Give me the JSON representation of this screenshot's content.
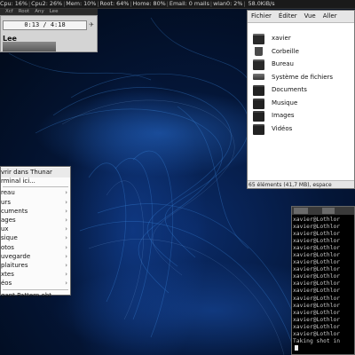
{
  "topbar": {
    "items": [
      {
        "label": "Cpu:",
        "value": "16%"
      },
      {
        "label": "Cpu2:",
        "value": "26%"
      },
      {
        "label": "Mem:",
        "value": "10%"
      },
      {
        "label": "Root:",
        "value": "64%"
      },
      {
        "label": "Home:",
        "value": "80%"
      },
      {
        "label": "Email:",
        "value": "0 mails"
      },
      {
        "label": "wlan0:",
        "value": "2%"
      },
      {
        "label": "",
        "value": "58.0KiB/s"
      }
    ]
  },
  "taskbar_tabs": [
    "Xcf",
    "Root",
    "Any",
    "Lee"
  ],
  "player": {
    "time": "0:13 / 4:18",
    "artist": "Lee",
    "button_glyph": "✈"
  },
  "file_manager": {
    "menu": [
      "Fichier",
      "Éditer",
      "Vue",
      "Aller"
    ],
    "items": [
      {
        "label": "xavier",
        "icon": "home-folder-icon"
      },
      {
        "label": "Corbeille",
        "icon": "trash-icon"
      },
      {
        "label": "Bureau",
        "icon": "desktop-folder-icon"
      },
      {
        "label": "Système de fichiers",
        "icon": "drive-icon"
      },
      {
        "label": "Documents",
        "icon": "folder-icon"
      },
      {
        "label": "Musique",
        "icon": "folder-icon"
      },
      {
        "label": "Images",
        "icon": "folder-icon"
      },
      {
        "label": "Vidéos",
        "icon": "folder-icon"
      }
    ],
    "status": "65 éléments (41,7 MB), espace"
  },
  "context_menu": {
    "items": [
      {
        "label": "vrir dans Thunar",
        "submenu": false
      },
      {
        "label": "rminal ici...",
        "submenu": false
      },
      {
        "label": "reau",
        "submenu": true
      },
      {
        "label": "urs",
        "submenu": true
      },
      {
        "label": "cuments",
        "submenu": true
      },
      {
        "label": "ages",
        "submenu": true
      },
      {
        "label": "ux",
        "submenu": true
      },
      {
        "label": "sique",
        "submenu": true
      },
      {
        "label": "otos",
        "submenu": true
      },
      {
        "label": "uvegarde",
        "submenu": true
      },
      {
        "label": "plaitures",
        "submenu": true
      },
      {
        "label": "xtes",
        "submenu": true
      },
      {
        "label": "éos",
        "submenu": true
      },
      {
        "label": "gant Pattern.obt",
        "submenu": false
      }
    ]
  },
  "terminal": {
    "tabs": [
      "",
      ""
    ],
    "lines": [
      "xavier@Lothlor",
      "xavier@Lothlor",
      "xavier@Lothlor",
      "xavier@Lothlor",
      "xavier@Lothlor",
      "xavier@Lothlor",
      "xavier@Lothlor",
      "xavier@Lothlor",
      "xavier@Lothlor",
      "xavier@Lothlor",
      "xavier@Lothlor",
      "xavier@Lothlor",
      "xavier@Lothlor",
      "xavier@Lothlor",
      "xavier@Lothlor",
      "xavier@Lothlor",
      "xavier@Lothlor",
      "Taking shot in"
    ]
  },
  "colors": {
    "wallpaper": "#041638",
    "folder": "#222222",
    "terminal_bg": "#000000"
  }
}
